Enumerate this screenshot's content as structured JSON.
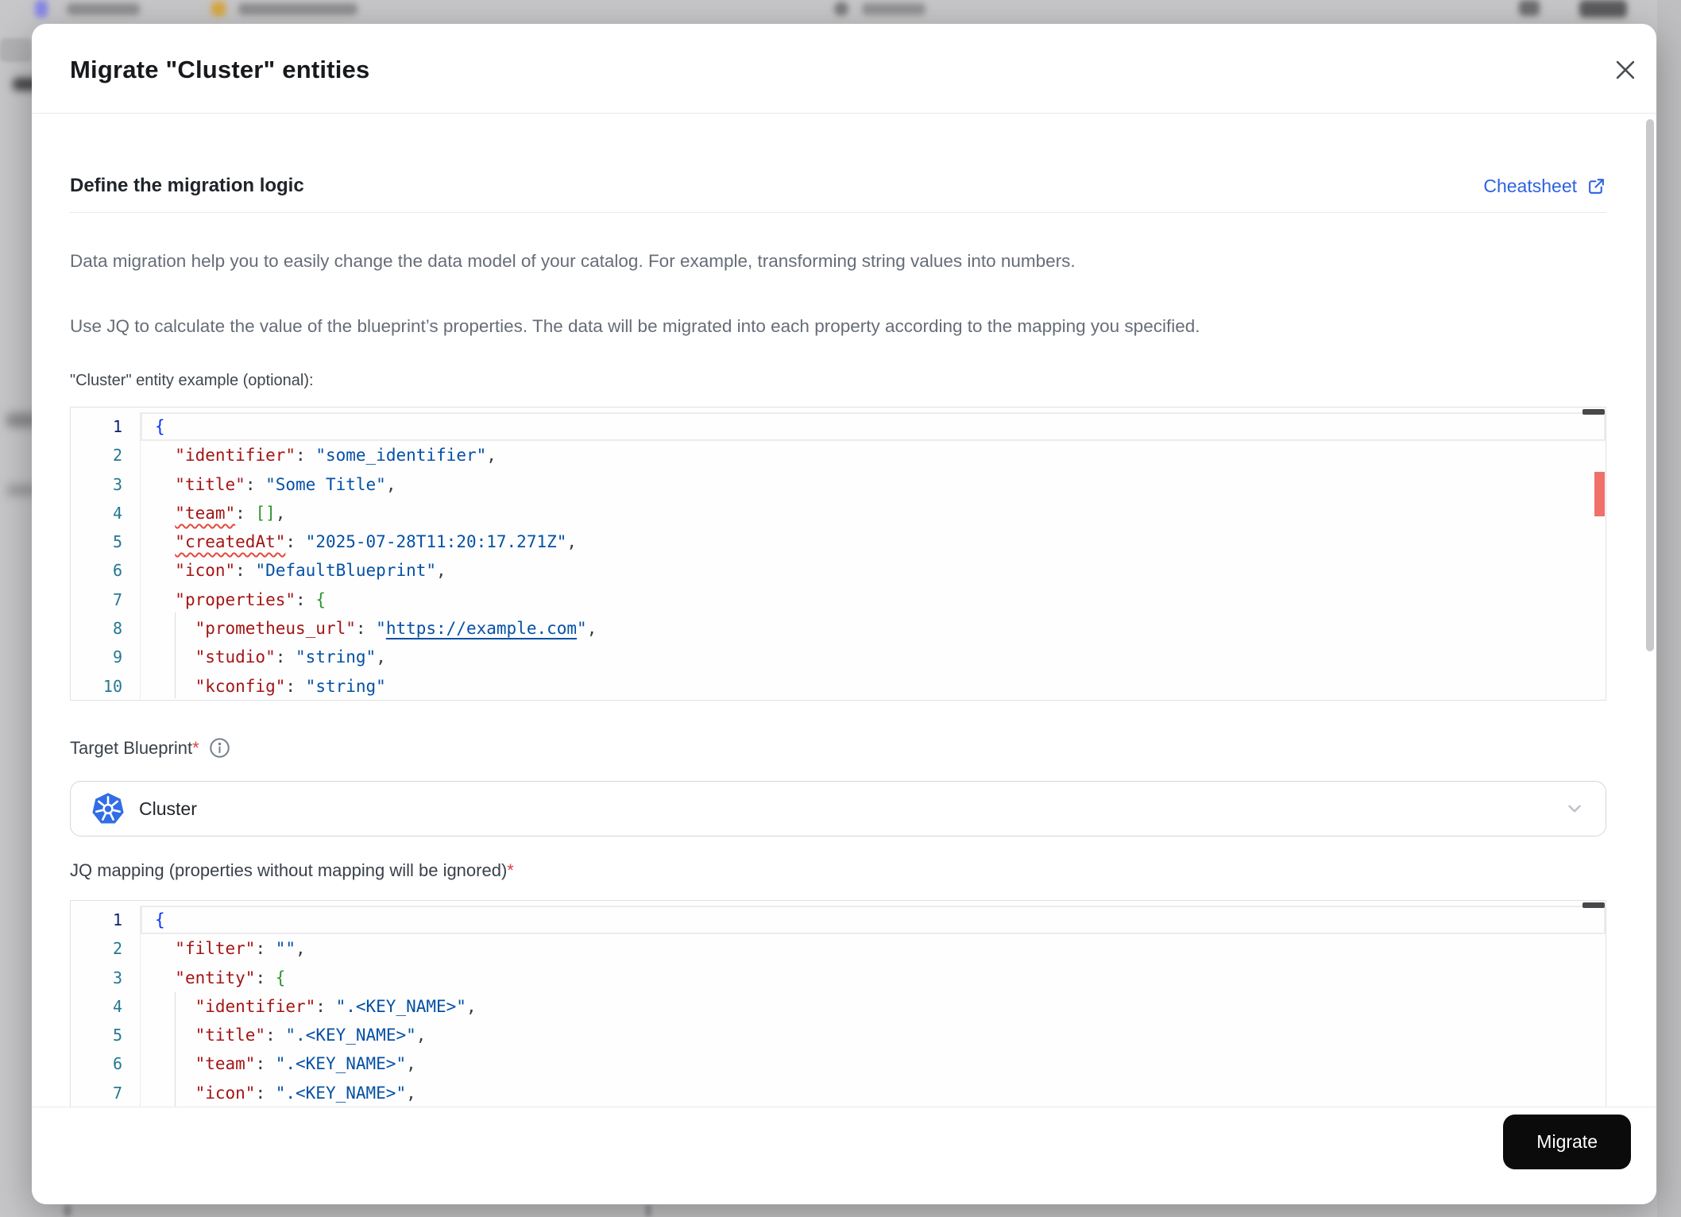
{
  "header": {
    "title": "Migrate \"Cluster\" entities"
  },
  "section": {
    "heading": "Define the migration logic",
    "cheatsheet_label": "Cheatsheet"
  },
  "intro": {
    "p1": "Data migration help you to easily change the data model of your catalog. For example, transforming string values into numbers.",
    "p2": "Use JQ to calculate the value of the blueprint’s properties. The data will be migrated into each property according to the mapping you specified."
  },
  "example_editor": {
    "label": "\"Cluster\" entity example (optional):",
    "start_line": 1,
    "lines": [
      [
        [
          "b1",
          "{"
        ]
      ],
      [
        [
          "p",
          "  "
        ],
        [
          "k",
          "\"identifier\""
        ],
        [
          "p",
          ": "
        ],
        [
          "s",
          "\"some_identifier\""
        ],
        [
          "p",
          ","
        ]
      ],
      [
        [
          "p",
          "  "
        ],
        [
          "k",
          "\"title\""
        ],
        [
          "p",
          ": "
        ],
        [
          "s",
          "\"Some Title\""
        ],
        [
          "p",
          ","
        ]
      ],
      [
        [
          "p",
          "  "
        ],
        [
          "ku",
          "\"team\""
        ],
        [
          "p",
          ": "
        ],
        [
          "b2",
          "[]"
        ],
        [
          "p",
          ","
        ]
      ],
      [
        [
          "p",
          "  "
        ],
        [
          "ku",
          "\"createdAt\""
        ],
        [
          "p",
          ": "
        ],
        [
          "s",
          "\"2025-07-28T11:20:17.271Z\""
        ],
        [
          "p",
          ","
        ]
      ],
      [
        [
          "p",
          "  "
        ],
        [
          "k",
          "\"icon\""
        ],
        [
          "p",
          ": "
        ],
        [
          "s",
          "\"DefaultBlueprint\""
        ],
        [
          "p",
          ","
        ]
      ],
      [
        [
          "p",
          "  "
        ],
        [
          "k",
          "\"properties\""
        ],
        [
          "p",
          ": "
        ],
        [
          "b2",
          "{"
        ]
      ],
      [
        [
          "p",
          "    "
        ],
        [
          "k",
          "\"prometheus_url\""
        ],
        [
          "p",
          ": "
        ],
        [
          "s",
          "\""
        ],
        [
          "su",
          "https://example.com"
        ],
        [
          "s",
          "\""
        ],
        [
          "p",
          ","
        ]
      ],
      [
        [
          "p",
          "    "
        ],
        [
          "k",
          "\"studio\""
        ],
        [
          "p",
          ": "
        ],
        [
          "s",
          "\"string\""
        ],
        [
          "p",
          ","
        ]
      ],
      [
        [
          "p",
          "    "
        ],
        [
          "k",
          "\"kconfig\""
        ],
        [
          "p",
          ": "
        ],
        [
          "s",
          "\"string\""
        ]
      ]
    ]
  },
  "target_blueprint": {
    "label": "Target Blueprint",
    "required_mark": "*",
    "value": "Cluster",
    "icon": "kubernetes-icon"
  },
  "jq_mapping": {
    "label": "JQ mapping (properties without mapping will be ignored)",
    "required_mark": "*",
    "start_line": 1,
    "lines": [
      [
        [
          "b1",
          "{"
        ]
      ],
      [
        [
          "p",
          "  "
        ],
        [
          "k",
          "\"filter\""
        ],
        [
          "p",
          ": "
        ],
        [
          "s",
          "\"\""
        ],
        [
          "p",
          ","
        ]
      ],
      [
        [
          "p",
          "  "
        ],
        [
          "k",
          "\"entity\""
        ],
        [
          "p",
          ": "
        ],
        [
          "b2",
          "{"
        ]
      ],
      [
        [
          "p",
          "    "
        ],
        [
          "k",
          "\"identifier\""
        ],
        [
          "p",
          ": "
        ],
        [
          "s",
          "\".<KEY_NAME>\""
        ],
        [
          "p",
          ","
        ]
      ],
      [
        [
          "p",
          "    "
        ],
        [
          "k",
          "\"title\""
        ],
        [
          "p",
          ": "
        ],
        [
          "s",
          "\".<KEY_NAME>\""
        ],
        [
          "p",
          ","
        ]
      ],
      [
        [
          "p",
          "    "
        ],
        [
          "k",
          "\"team\""
        ],
        [
          "p",
          ": "
        ],
        [
          "s",
          "\".<KEY_NAME>\""
        ],
        [
          "p",
          ","
        ]
      ],
      [
        [
          "p",
          "    "
        ],
        [
          "k",
          "\"icon\""
        ],
        [
          "p",
          ": "
        ],
        [
          "s",
          "\".<KEY_NAME>\""
        ],
        [
          "p",
          ","
        ]
      ]
    ]
  },
  "footer": {
    "migrate_label": "Migrate"
  },
  "colors": {
    "link_blue": "#2e62e2",
    "json_key": "#a31515",
    "json_string": "#0451a5",
    "brace_blue": "#0431fa",
    "bracket_green": "#319331",
    "line_number": "#237893",
    "error_marker": "#f0706a",
    "required_red": "#d7453c",
    "button_bg": "#0b0b0c",
    "kubernetes_blue": "#326de6"
  }
}
